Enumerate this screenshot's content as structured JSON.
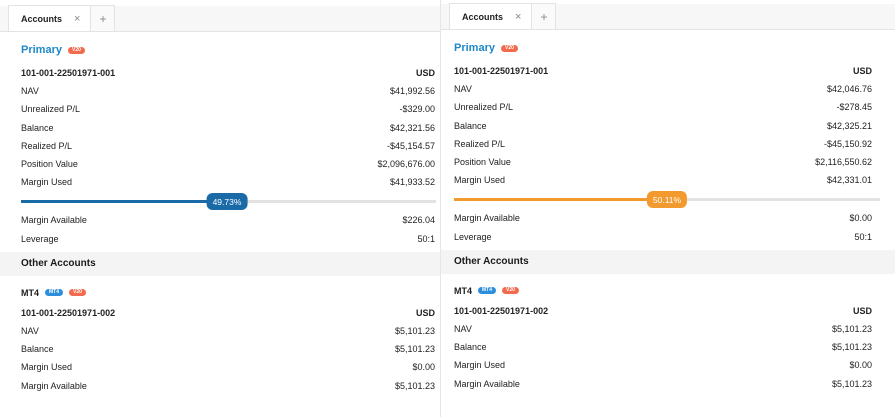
{
  "panels": [
    {
      "tab": {
        "label": "Accounts",
        "close": "×",
        "add": "+"
      },
      "primary": {
        "title": "Primary",
        "badge": "V20",
        "account_id": "101-001-22501971-001",
        "currency": "USD",
        "rows_top": [
          {
            "label": "NAV",
            "value": "$41,992.56"
          },
          {
            "label": "Unrealized P/L",
            "value": "-$329.00"
          },
          {
            "label": "Balance",
            "value": "$42,321.56"
          },
          {
            "label": "Realized P/L",
            "value": "-$45,154.57"
          },
          {
            "label": "Position Value",
            "value": "$2,096,676.00"
          },
          {
            "label": "Margin Used",
            "value": "$41,933.52"
          }
        ],
        "margin_gauge": {
          "label": "49.73%",
          "percent": 49.73,
          "color": "#1a6aa8"
        },
        "rows_bottom": [
          {
            "label": "Margin Available",
            "value": "$226.04"
          },
          {
            "label": "Leverage",
            "value": "50:1"
          }
        ]
      },
      "other": {
        "header": "Other Accounts",
        "title": "MT4",
        "badges": [
          "MT4",
          "V20"
        ],
        "account_id": "101-001-22501971-002",
        "currency": "USD",
        "rows": [
          {
            "label": "NAV",
            "value": "$5,101.23"
          },
          {
            "label": "Balance",
            "value": "$5,101.23"
          },
          {
            "label": "Margin Used",
            "value": "$0.00"
          },
          {
            "label": "Margin Available",
            "value": "$5,101.23"
          }
        ]
      }
    },
    {
      "tab": {
        "label": "Accounts",
        "close": "×",
        "add": "+"
      },
      "primary": {
        "title": "Primary",
        "badge": "V20",
        "account_id": "101-001-22501971-001",
        "currency": "USD",
        "rows_top": [
          {
            "label": "NAV",
            "value": "$42,046.76"
          },
          {
            "label": "Unrealized P/L",
            "value": "-$278.45"
          },
          {
            "label": "Balance",
            "value": "$42,325.21"
          },
          {
            "label": "Realized P/L",
            "value": "-$45,150.92"
          },
          {
            "label": "Position Value",
            "value": "$2,116,550.62"
          },
          {
            "label": "Margin Used",
            "value": "$42,331.01"
          }
        ],
        "margin_gauge": {
          "label": "50.11%",
          "percent": 50.11,
          "color": "#f39a2e"
        },
        "rows_bottom": [
          {
            "label": "Margin Available",
            "value": "$0.00"
          },
          {
            "label": "Leverage",
            "value": "50:1"
          }
        ]
      },
      "other": {
        "header": "Other Accounts",
        "title": "MT4",
        "badges": [
          "MT4",
          "V20"
        ],
        "account_id": "101-001-22501971-002",
        "currency": "USD",
        "rows": [
          {
            "label": "NAV",
            "value": "$5,101.23"
          },
          {
            "label": "Balance",
            "value": "$5,101.23"
          },
          {
            "label": "Margin Used",
            "value": "$0.00"
          },
          {
            "label": "Margin Available",
            "value": "$5,101.23"
          }
        ]
      }
    }
  ]
}
